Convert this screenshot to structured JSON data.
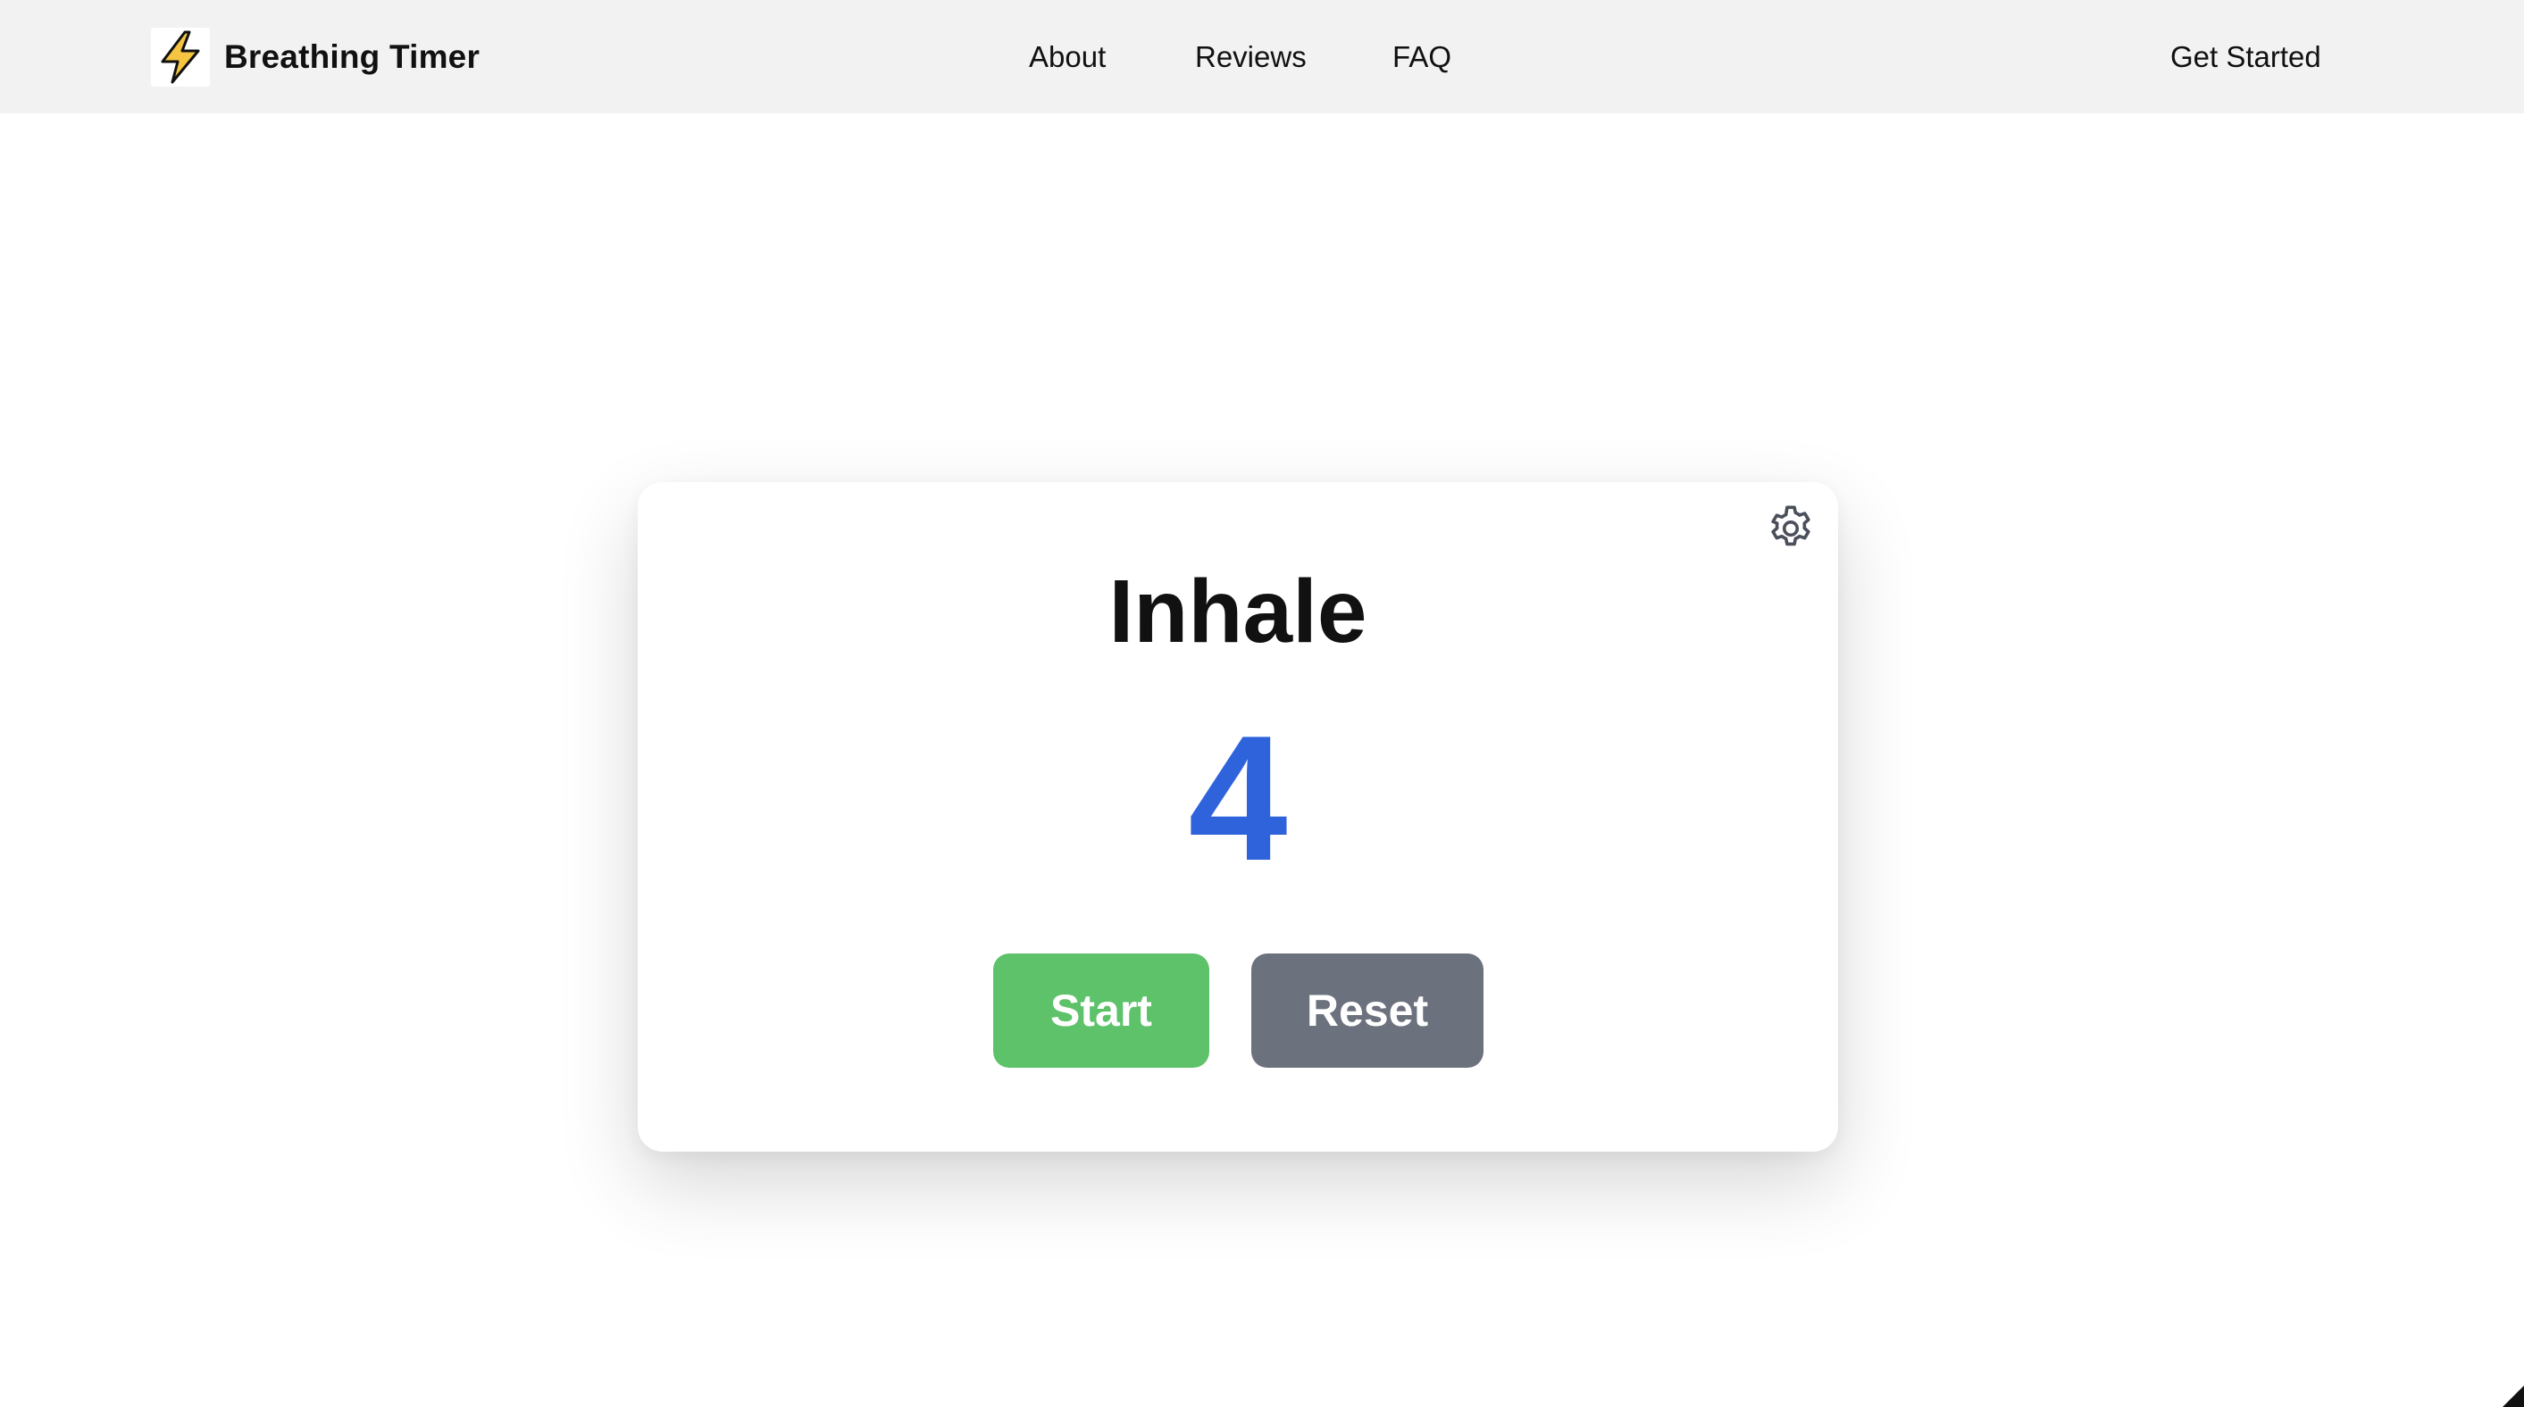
{
  "header": {
    "brand": {
      "icon": "lightning-bolt-icon",
      "name": "Breathing Timer"
    },
    "nav": {
      "about": "About",
      "reviews": "Reviews",
      "faq": "FAQ"
    },
    "cta_label": "Get Started"
  },
  "timer": {
    "settings_icon": "gear-icon",
    "phase": "Inhale",
    "count": "4",
    "start_label": "Start",
    "reset_label": "Reset"
  },
  "colors": {
    "header_bg": "#f2f2f2",
    "count_blue": "#2f63dc",
    "start_green": "#5ec26a",
    "reset_gray": "#6c717e",
    "bolt_yellow": "#f5c542"
  }
}
